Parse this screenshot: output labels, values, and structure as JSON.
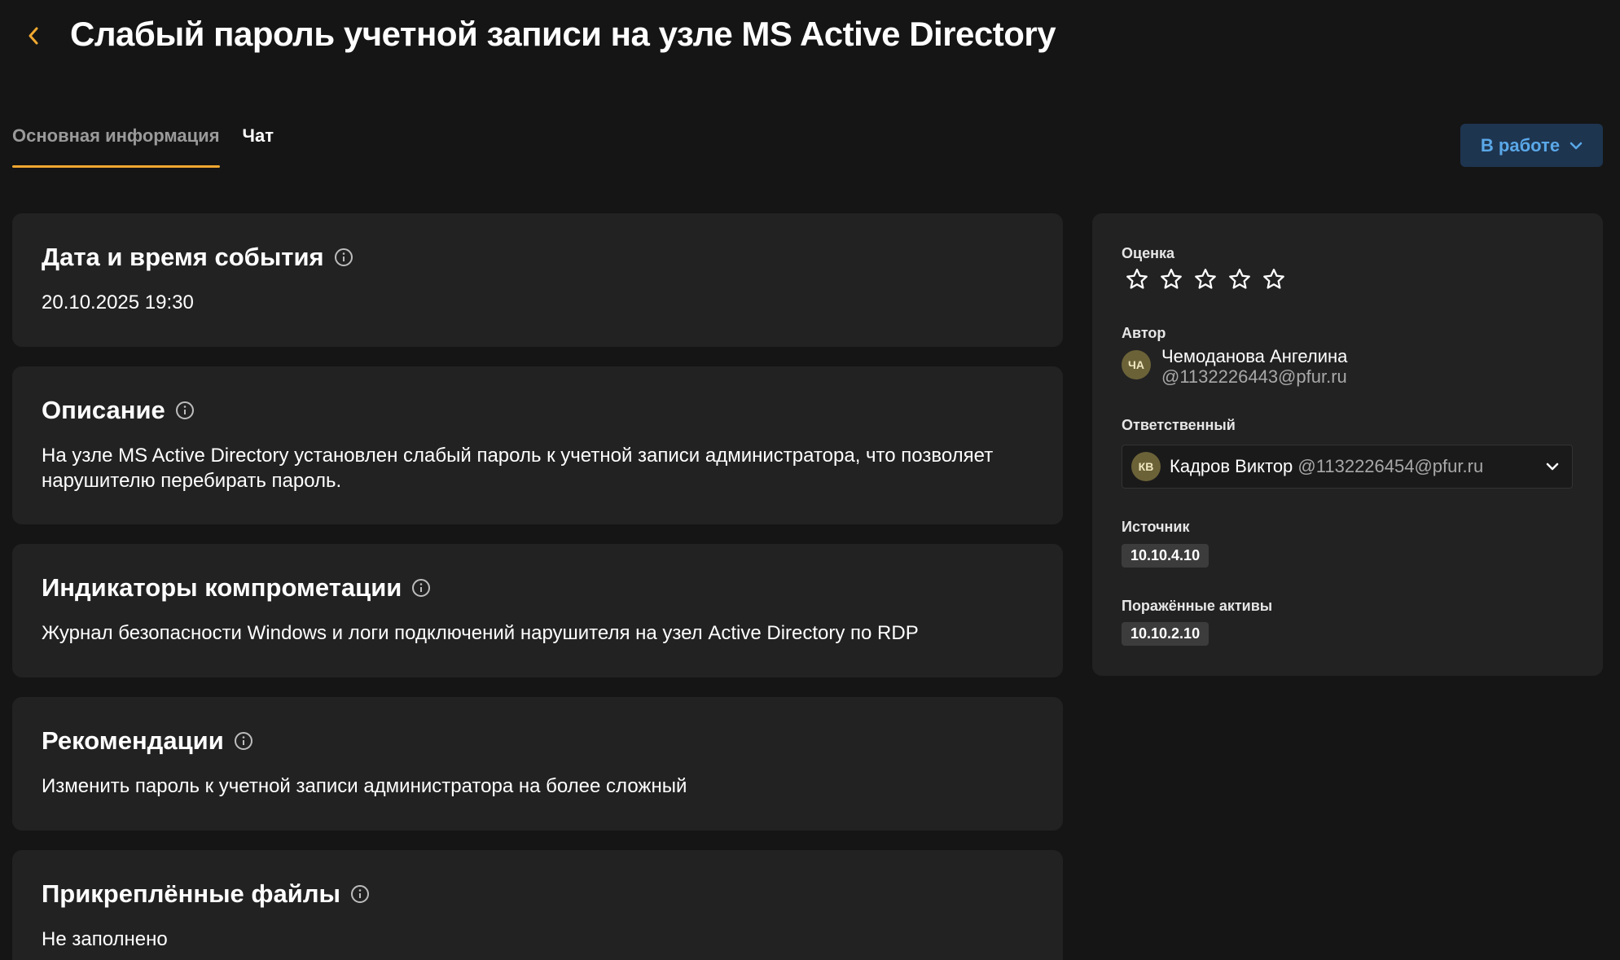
{
  "header": {
    "title": "Слабый пароль учетной записи на узле MS Active Directory",
    "back_icon": "chevron-left-icon",
    "accent_color": "#f0a830"
  },
  "tabs": [
    {
      "label": "Основная информация",
      "active": true
    },
    {
      "label": "Чат",
      "active": false
    }
  ],
  "status": {
    "label": "В работе",
    "icon": "chevron-down-icon",
    "color": "#5aa8e8",
    "background": "#1e3550"
  },
  "sections": {
    "datetime": {
      "title": "Дата и время события",
      "value": "20.10.2025 19:30"
    },
    "description": {
      "title": "Описание",
      "value": "На узле MS Active Directory установлен слабый пароль к учетной записи администратора, что позволяет нарушителю перебирать пароль."
    },
    "indicators": {
      "title": "Индикаторы компрометации",
      "value": "Журнал безопасности Windows и логи подключений нарушителя на узел Active Directory по RDP"
    },
    "recommendations": {
      "title": "Рекомендации",
      "value": "Изменить пароль к учетной записи администратора на более сложный"
    },
    "attachments": {
      "title": "Прикреплённые файлы",
      "value": "Не заполнено"
    }
  },
  "sidebar": {
    "rating": {
      "label": "Оценка",
      "max": 5,
      "value": 0
    },
    "author": {
      "label": "Автор",
      "initials": "ЧА",
      "name": "Чемоданова Ангелина",
      "email": "@1132226443@pfur.ru"
    },
    "assignee": {
      "label": "Ответственный",
      "initials": "КВ",
      "name": "Кадров Виктор",
      "email": "@1132226454@pfur.ru"
    },
    "source": {
      "label": "Источник",
      "value": "10.10.4.10"
    },
    "affected": {
      "label": "Поражённые активы",
      "value": "10.10.2.10"
    }
  }
}
